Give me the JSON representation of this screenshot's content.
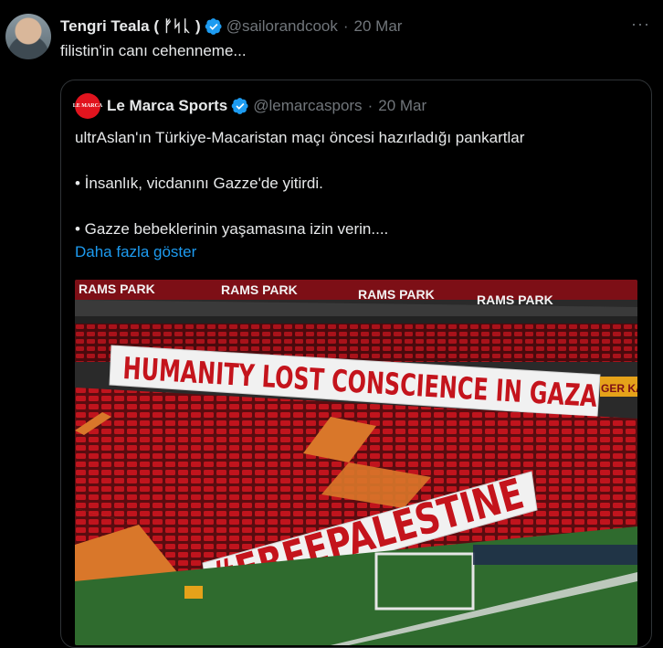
{
  "tweet": {
    "author_name": "Tengri Teala ( ᚠᛋᚳ )",
    "handle": "@sailorandcook",
    "separator": "·",
    "time": "20 Mar",
    "text": "filistin'in canı cehenneme...",
    "more": "···"
  },
  "quote": {
    "logo_text": "LE MARCA",
    "author_name": "Le Marca Sports",
    "handle": "@lemarcaspors",
    "separator": "·",
    "time": "20 Mar",
    "line1": "ultrAslan'ın Türkiye-Macaristan maçı öncesi hazırladığı pankartlar",
    "line2": "• İnsanlık, vicdanını Gazze'de yitirdi.",
    "line3": "• Gazze bebeklerinin yaşamasına izin verin....",
    "show_more": "Daha fazla göster"
  },
  "photo": {
    "stadium_sign": "RAMS PARK",
    "banner_top": "HUMANITY LOST CONSCIENCE IN GAZA",
    "banner_bottom": "#FREEPALESTINE",
    "side_sign": "GER KAT"
  },
  "colors": {
    "accent": "#1d9bf0",
    "verified": "#1d9bf0",
    "muted": "#71767b",
    "seat_red": "#b3121a"
  }
}
